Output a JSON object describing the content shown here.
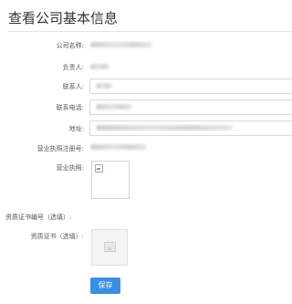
{
  "page": {
    "title": "查看公司基本信息"
  },
  "form": {
    "company_name_label": "公司名称:",
    "principal_label": "负责人:",
    "contact_label": "联系人:",
    "phone_label": "联系电话:",
    "address_label": "地址:",
    "license_number_label": "营业执照注册号:",
    "license_label": "营业执照:",
    "qualification_number_label": "资质证书编号（选填）:",
    "qualification_label": "资质证书（选填）:"
  },
  "actions": {
    "save_label": "保存"
  },
  "colors": {
    "accent": "#3b8fde",
    "border": "#d9d9d9",
    "label": "#555555"
  }
}
